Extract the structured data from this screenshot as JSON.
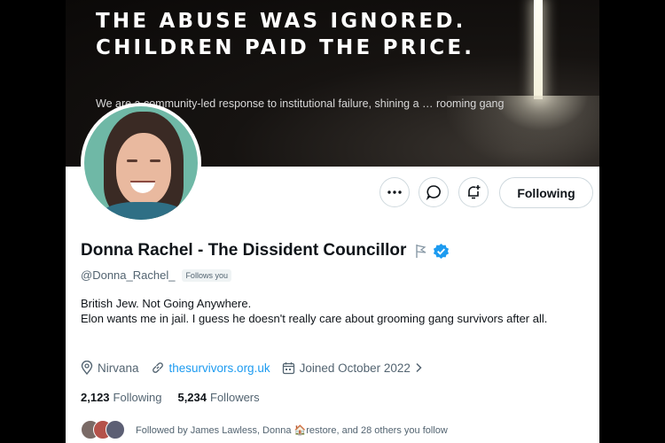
{
  "banner": {
    "headline": "THE ABUSE WAS IGNORED.\nCHILDREN PAID THE PRICE.",
    "tagline": "We are a community-led response to institutional failure, shining a … rooming gang scandal."
  },
  "actions": {
    "more_icon": "ellipsis-icon",
    "message_icon": "message-bubble-icon",
    "notify_icon": "bell-plus-icon",
    "following_label": "Following"
  },
  "profile": {
    "name": "Donna Rachel - The Dissident Councillor",
    "handle": "@Donna_Rachel_",
    "follows_you": "Follows you",
    "bio_line1": "British Jew. Not Going Anywhere.",
    "bio_line2": "Elon wants me in jail. I guess he doesn't really care about grooming gang survivors after all.",
    "location": "Nirvana",
    "website": "thesurvivors.org.uk",
    "joined": "Joined October 2022",
    "following_count": "2,123",
    "following_label": "Following",
    "followers_count": "5,234",
    "followers_label": "Followers",
    "followed_by": "Followed by James Lawless, Donna 🏠restore, and 28 others you follow"
  },
  "colors": {
    "accent": "#1d9bf0",
    "verified": "#1d9bf0",
    "text": "#0f1419",
    "muted": "#536471"
  }
}
